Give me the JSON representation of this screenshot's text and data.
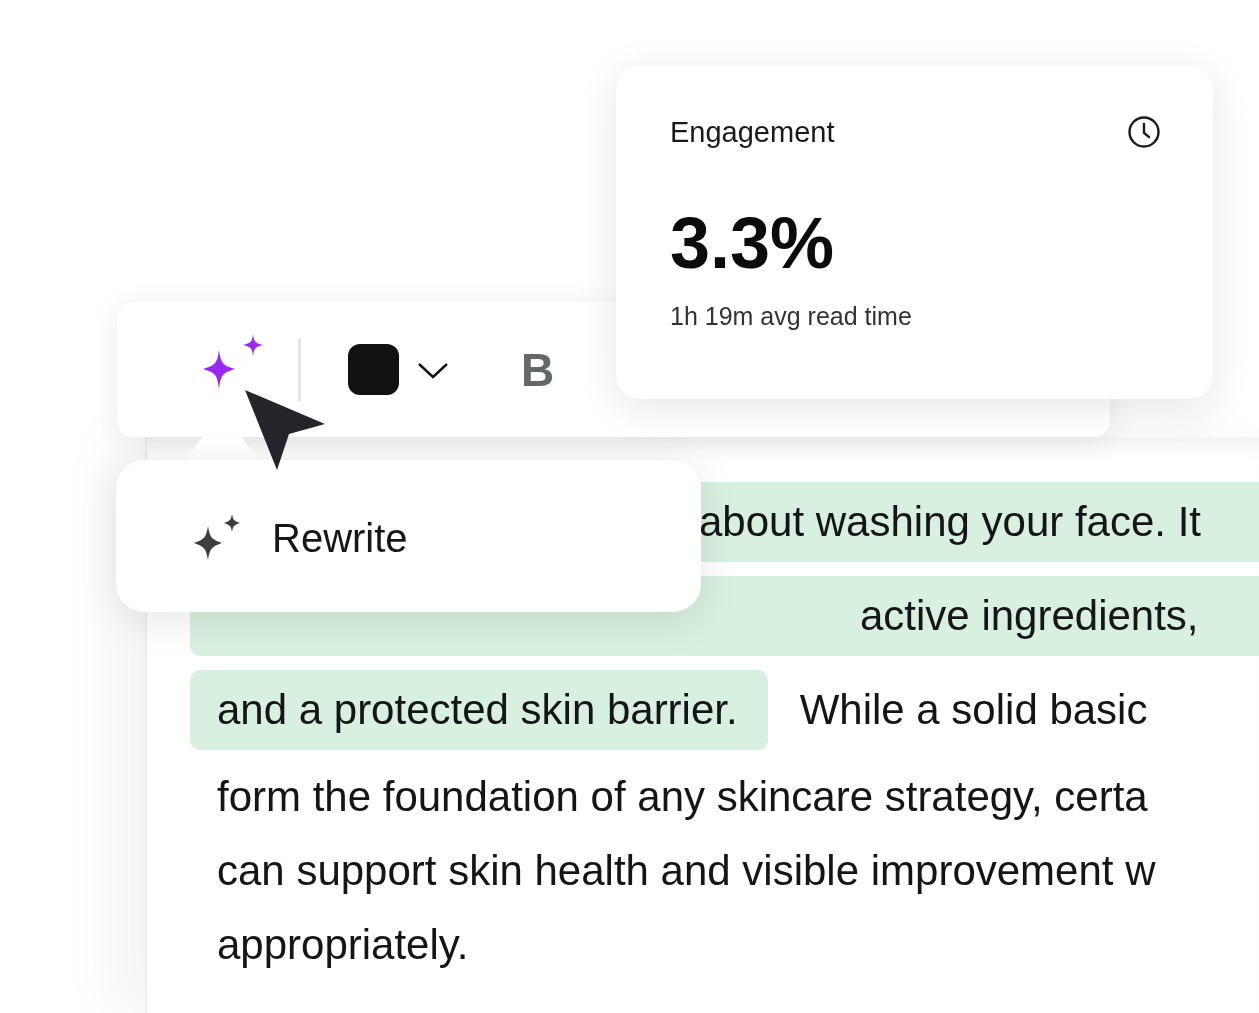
{
  "toolbar": {
    "bold_label": "B"
  },
  "engagement_card": {
    "title": "Engagement",
    "value": "3.3%",
    "caption": "1h 19m avg read time"
  },
  "popup": {
    "items": [
      {
        "label": "Rewrite"
      }
    ]
  },
  "document": {
    "lines": [
      {
        "segments": [
          {
            "text": "about washing your face. It",
            "highlighted": true
          }
        ]
      },
      {
        "segments": [
          {
            "text": "active ingredients,",
            "highlighted": true
          }
        ]
      },
      {
        "segments": [
          {
            "text": "and a protected skin barrier.",
            "highlighted": true
          },
          {
            "text": "While a solid basic",
            "highlighted": false
          }
        ]
      },
      {
        "segments": [
          {
            "text": "form the foundation of any skincare strategy, certa",
            "highlighted": false
          }
        ]
      },
      {
        "segments": [
          {
            "text": "can support skin health and visible improvement w",
            "highlighted": false
          }
        ]
      },
      {
        "segments": [
          {
            "text": "appropriately.",
            "highlighted": false
          }
        ]
      }
    ]
  }
}
